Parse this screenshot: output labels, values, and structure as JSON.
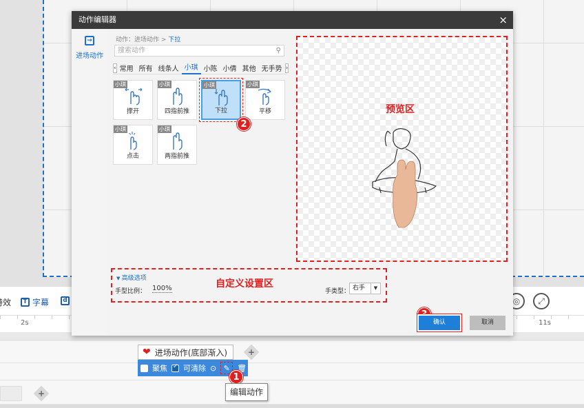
{
  "dialog": {
    "title": "动作编辑器",
    "close_label": "×",
    "side_item": "进场动作",
    "breadcrumb_prefix": "动作：进场动作 >",
    "breadcrumb_current": "下拉",
    "search_placeholder": "搜索动作",
    "tabs": [
      "常用",
      "所有",
      "线条人",
      "小琪",
      "小陈",
      "小倩",
      "其他",
      "无手势"
    ],
    "active_tab": "小琪",
    "cards": [
      {
        "badge": "小琪",
        "label": "撑开"
      },
      {
        "badge": "小琪",
        "label": "四指前推"
      },
      {
        "badge": "小琪",
        "label": "下拉"
      },
      {
        "badge": "小琪",
        "label": "平移"
      },
      {
        "badge": "小琪",
        "label": "点击"
      },
      {
        "badge": "小琪",
        "label": "两指前推"
      }
    ],
    "selected_card": "下拉",
    "preview_label": "预览区",
    "advanced_title": "高级选项",
    "hand_ratio_label": "手型比例：",
    "hand_ratio_value": "100%",
    "custom_zone_label": "自定义设置区",
    "hand_type_label": "手类型：",
    "hand_type_value": "右手",
    "ok_label": "确认",
    "cancel_label": "取消"
  },
  "toolbar": {
    "effect_label": "特效",
    "subtitle_label": "字幕",
    "third_icon": "d"
  },
  "ruler": {
    "ticks": [
      "2s",
      "11s"
    ]
  },
  "timeline": {
    "action_tag": "进场动作(底部渐入)",
    "focus_label": "聚焦",
    "removable_label": "可清除",
    "tooltip": "编辑动作"
  },
  "markers": [
    "1",
    "2",
    "3"
  ],
  "colors": {
    "accent": "#1e6fc8",
    "annotation": "#e02020",
    "title_bar": "#3a3a3a"
  },
  "icons": [
    "close-icon",
    "enter-action-icon",
    "search-icon",
    "hand-icon",
    "heart-icon",
    "plus-icon",
    "pen-icon",
    "trash-icon",
    "eye-icon",
    "expand-icon"
  ]
}
